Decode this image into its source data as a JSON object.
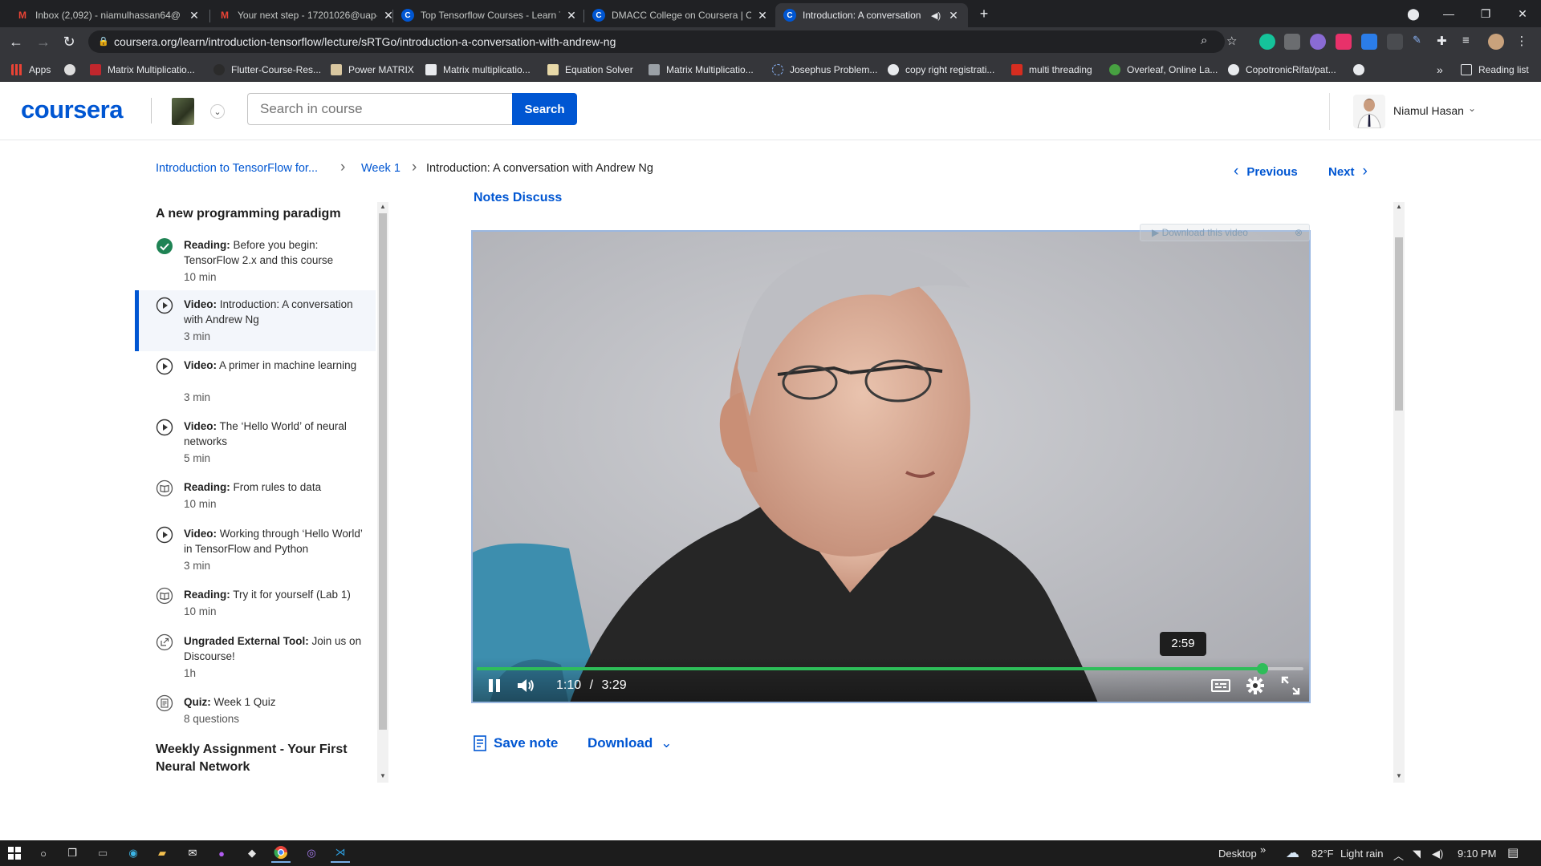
{
  "browser": {
    "tabs": [
      {
        "title": "Inbox (2,092) - niamulhassan64@",
        "favicon": "gmail-icon"
      },
      {
        "title": "Your next step - 17201026@uap-",
        "favicon": "gmail-icon"
      },
      {
        "title": "Top Tensorflow Courses - Learn T",
        "favicon": "coursera-icon"
      },
      {
        "title": "DMACC College on Coursera | Co",
        "favicon": "coursera-icon"
      },
      {
        "title": "Introduction: A conversation",
        "favicon": "coursera-icon",
        "active": true
      }
    ],
    "url": "coursera.org/learn/introduction-tensorflow/lecture/sRTGo/introduction-a-conversation-with-andrew-ng",
    "bookmarks": [
      "Apps",
      "Matrix Multiplicatio...",
      "Flutter-Course-Res...",
      "Power MATRIX",
      "Matrix multiplicatio...",
      "Equation Solver",
      "Matrix Multiplicatio...",
      "Josephus Problem...",
      "copy right registrati...",
      "multi threading",
      "Overleaf, Online La...",
      "CopotronicRifat/pat..."
    ],
    "reading_list": "Reading list",
    "more": "»"
  },
  "header": {
    "logo": "coursera",
    "search_placeholder": "Search in course",
    "search_button": "Search",
    "user_name": "Niamul Hasan"
  },
  "breadcrumb": {
    "course": "Introduction to TensorFlow for...",
    "week": "Week 1",
    "current": "Introduction: A conversation with Andrew Ng",
    "previous": "Previous",
    "next": "Next"
  },
  "sidebar": {
    "section_title": "A new programming paradigm",
    "items": [
      {
        "type": "Reading:",
        "title": "Before you begin: TensorFlow 2.x and this course",
        "duration": "10 min",
        "icon": "check-circle-icon",
        "state": "completed"
      },
      {
        "type": "Video:",
        "title": "Introduction: A conversation with Andrew Ng",
        "duration": "3 min",
        "icon": "play-circle-icon",
        "state": "active"
      },
      {
        "type": "Video:",
        "title": "A primer in machine learning",
        "duration": "3 min",
        "icon": "play-circle-icon"
      },
      {
        "type": "Video:",
        "title": "The ‘Hello World’ of neural networks",
        "duration": "5 min",
        "icon": "play-circle-icon"
      },
      {
        "type": "Reading:",
        "title": "From rules to data",
        "duration": "10 min",
        "icon": "book-icon"
      },
      {
        "type": "Video:",
        "title": "Working through ‘Hello World’ in TensorFlow and Python",
        "duration": "3 min",
        "icon": "play-circle-icon"
      },
      {
        "type": "Reading:",
        "title": "Try it for yourself (Lab 1)",
        "duration": "10 min",
        "icon": "book-icon"
      },
      {
        "type": "Ungraded External Tool:",
        "title": "Join us on Discourse!",
        "duration": "1h",
        "icon": "external-tool-icon"
      },
      {
        "type": "Quiz:",
        "title": "Week 1 Quiz",
        "duration": "8 questions",
        "icon": "quiz-icon"
      }
    ],
    "next_section_title": "Weekly Assignment - Your First Neural Network"
  },
  "main": {
    "tabs_partial": "Notes     Discuss",
    "video": {
      "download_overlay": "Download this video",
      "current_time": "1:10",
      "separator": "/",
      "duration": "3:29",
      "hover_time": "2:59",
      "progress": 0.95,
      "state": "playing"
    },
    "save_note": "Save note",
    "download": "Download"
  },
  "taskbar": {
    "desktop": "Desktop",
    "weather_temp": "82°F",
    "weather_text": "Light rain",
    "time": "9:10 PM"
  },
  "colors": {
    "brand": "#0056d2",
    "progress": "#2ebd59",
    "check": "#1f8354"
  }
}
